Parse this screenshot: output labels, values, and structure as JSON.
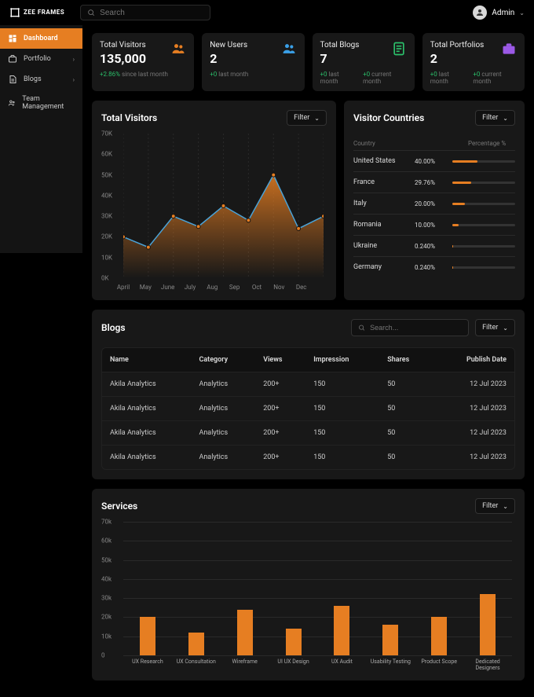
{
  "brand": "ZEE FRAMES",
  "search_placeholder_top": "Search",
  "admin_label": "Admin",
  "sidebar": {
    "items": [
      {
        "label": "Dashboard"
      },
      {
        "label": "Portfolio"
      },
      {
        "label": "Blogs"
      },
      {
        "label": "Team Management"
      }
    ]
  },
  "stats": {
    "visitors": {
      "title": "Total Visitors",
      "value": "135,000",
      "delta": "+2.86%",
      "delta_suffix": " since last month"
    },
    "new_users": {
      "title": "New Users",
      "value": "2",
      "sub_a": "+0",
      "sub_a_suffix": " last month"
    },
    "blogs": {
      "title": "Total Blogs",
      "value": "7",
      "sub_a": "+0",
      "sub_a_suffix": " last month",
      "sub_b": "+0",
      "sub_b_suffix": " current month"
    },
    "portfolios": {
      "title": "Total Portfolios",
      "value": "2",
      "sub_a": "+0",
      "sub_a_suffix": " last month",
      "sub_b": "+0",
      "sub_b_suffix": " current month"
    }
  },
  "filter_label": "Filter",
  "visitors_chart": {
    "title": "Total Visitors"
  },
  "chart_data": [
    {
      "type": "area",
      "title": "Total Visitors",
      "x": [
        "April",
        "May",
        "June",
        "July",
        "Aug",
        "Sep",
        "Oct",
        "Nov",
        "Dec"
      ],
      "values": [
        20,
        15,
        30,
        25,
        35,
        28,
        50,
        24,
        30
      ],
      "ylabel": "",
      "ylim": [
        0,
        70
      ],
      "yticks": [
        "0K",
        "10K",
        "20K",
        "30K",
        "40K",
        "50K",
        "60K",
        "70K"
      ]
    },
    {
      "type": "bar",
      "title": "Services",
      "categories": [
        "UX Research",
        "UX Consultation",
        "Wireframe",
        "UI UX Design",
        "UX Audit",
        "Usability Testing",
        "Product Scope",
        "Dedicated Designers"
      ],
      "values": [
        20,
        12,
        24,
        14,
        26,
        16,
        20,
        32
      ],
      "ylim": [
        0,
        70
      ],
      "yticks": [
        "0",
        "10k",
        "20k",
        "30k",
        "40k",
        "50k",
        "60k",
        "70k"
      ]
    }
  ],
  "visitor_countries": {
    "title": "Visitor Countries",
    "head_country": "Country",
    "head_pct": "Percentage %",
    "rows": [
      {
        "name": "United States",
        "pct": "40.00%",
        "fill": 40
      },
      {
        "name": "France",
        "pct": "29.76%",
        "fill": 29.76
      },
      {
        "name": "Italy",
        "pct": "20.00%",
        "fill": 20
      },
      {
        "name": "Romania",
        "pct": "10.00%",
        "fill": 10
      },
      {
        "name": "Ukraine",
        "pct": "0.240%",
        "fill": 1
      },
      {
        "name": "Germany",
        "pct": "0.240%",
        "fill": 1
      }
    ]
  },
  "blogs_section": {
    "title": "Blogs",
    "search_placeholder": "Search...",
    "columns": [
      "Name",
      "Category",
      "Views",
      "Impression",
      "Shares",
      "Publish Date"
    ],
    "rows": [
      {
        "name": "Akila Analytics",
        "category": "Analytics",
        "views": "200+",
        "impression": "150",
        "shares": "50",
        "date": "12 Jul 2023"
      },
      {
        "name": "Akila Analytics",
        "category": "Analytics",
        "views": "200+",
        "impression": "150",
        "shares": "50",
        "date": "12 Jul 2023"
      },
      {
        "name": "Akila Analytics",
        "category": "Analytics",
        "views": "200+",
        "impression": "150",
        "shares": "50",
        "date": "12 Jul 2023"
      },
      {
        "name": "Akila Analytics",
        "category": "Analytics",
        "views": "200+",
        "impression": "150",
        "shares": "50",
        "date": "12 Jul 2023"
      }
    ]
  },
  "services_section": {
    "title": "Services"
  }
}
